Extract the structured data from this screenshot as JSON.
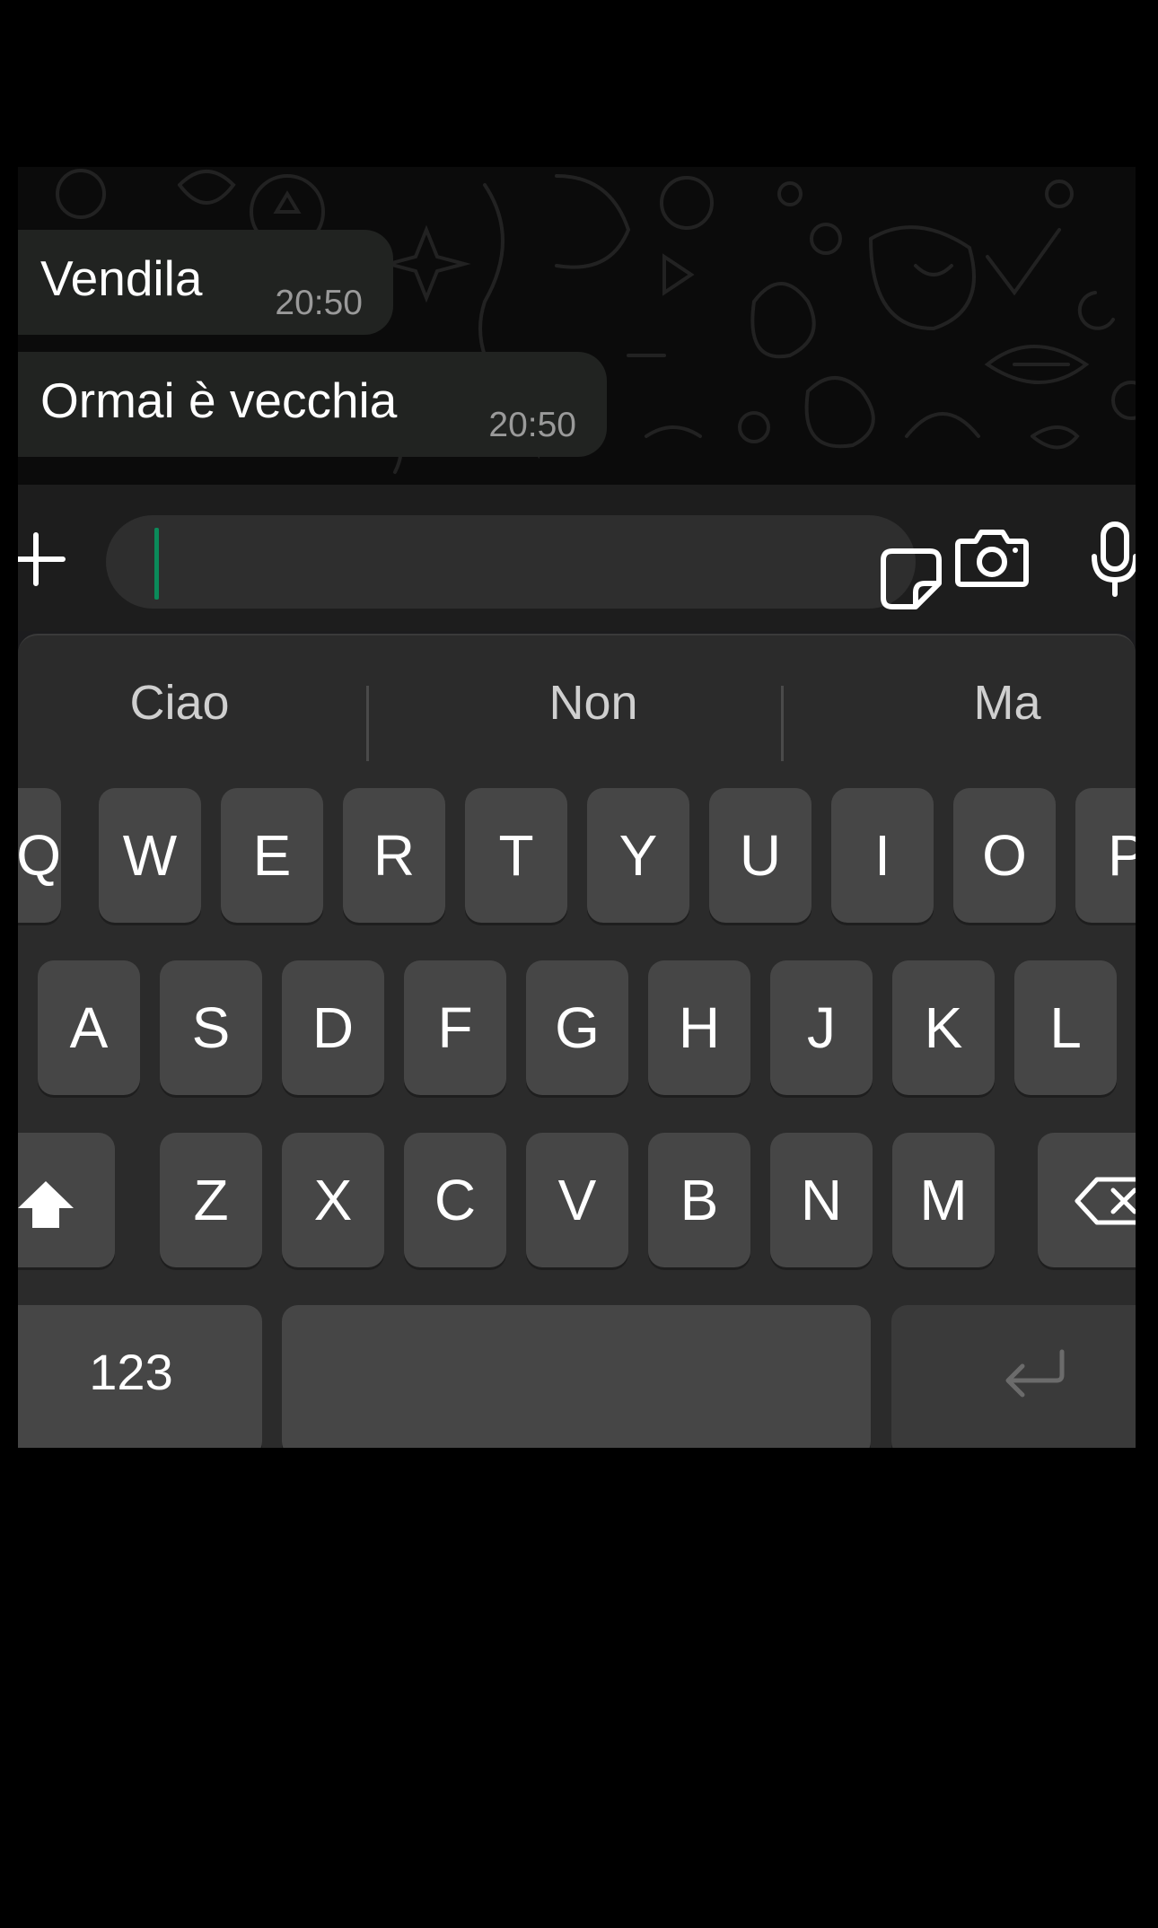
{
  "chat": {
    "messages": [
      {
        "text": "Vendila",
        "time": "20:50"
      },
      {
        "text": "Ormai è vecchia",
        "time": "20:50"
      }
    ]
  },
  "input": {
    "value": "",
    "accent_color": "#0b8a5a"
  },
  "icons": {
    "attach": "plus-icon",
    "sticker": "sticker-icon",
    "camera": "camera-icon",
    "microphone": "microphone-icon",
    "shift": "shift-icon",
    "backspace": "backspace-icon",
    "return": "return-icon"
  },
  "keyboard": {
    "suggestions": [
      "Ciao",
      "Non",
      "Ma"
    ],
    "row1": [
      "Q",
      "W",
      "E",
      "R",
      "T",
      "Y",
      "U",
      "I",
      "O",
      "P"
    ],
    "row2": [
      "A",
      "S",
      "D",
      "F",
      "G",
      "H",
      "J",
      "K",
      "L"
    ],
    "row3": [
      "Z",
      "X",
      "C",
      "V",
      "B",
      "N",
      "M"
    ],
    "numbers_label": "123",
    "space_label": ""
  }
}
